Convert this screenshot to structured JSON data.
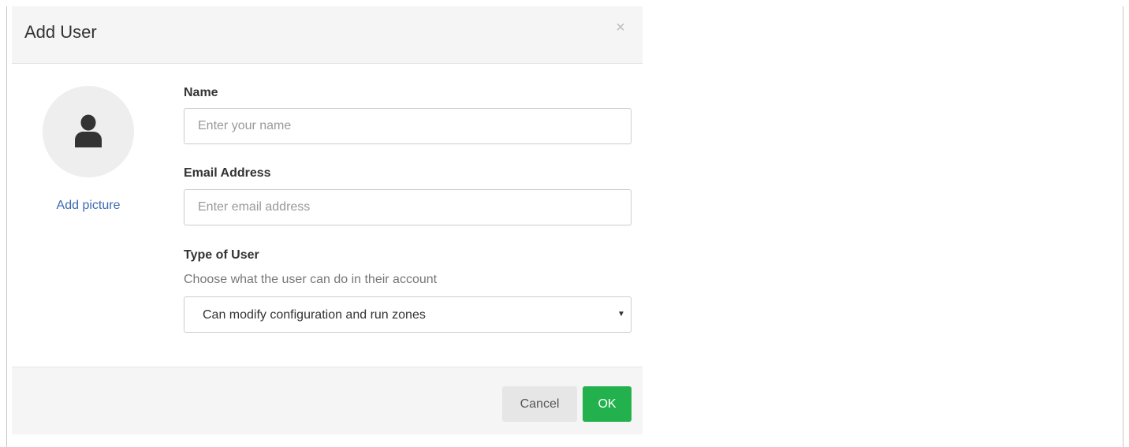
{
  "modal": {
    "title": "Add User",
    "close_icon": "close-icon",
    "close_glyph": "×"
  },
  "avatar": {
    "icon": "user-icon",
    "add_picture_label": "Add picture"
  },
  "form": {
    "name": {
      "label": "Name",
      "value": "",
      "placeholder": "Enter your name"
    },
    "email": {
      "label": "Email Address",
      "value": "",
      "placeholder": "Enter email address"
    },
    "user_type": {
      "label": "Type of User",
      "help": "Choose what the user can do in their account",
      "selected": "Can modify configuration and run zones",
      "arrow_icon": "caret-down-icon",
      "arrow_glyph": "▼"
    }
  },
  "footer": {
    "cancel_label": "Cancel",
    "ok_label": "OK"
  },
  "colors": {
    "header_bg": "#f5f5f5",
    "footer_bg": "#f5f5f5",
    "avatar_bg": "#eeeeee",
    "link": "#3d6bb3",
    "ok_button": "#22b14c",
    "cancel_button": "#e6e6e6"
  }
}
